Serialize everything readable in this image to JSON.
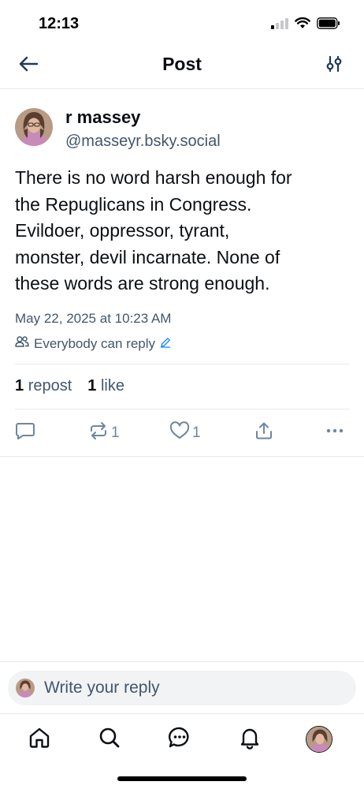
{
  "status_bar": {
    "time": "12:13"
  },
  "header": {
    "title": "Post"
  },
  "post": {
    "author_name": "r massey",
    "author_handle": "@masseyr.bsky.social",
    "text_lines": [
      "There is no word harsh enough for",
      "the Repuglicans in Congress.",
      "Evildoer, oppressor, tyrant,",
      "monster, devil incarnate. None of",
      "these words are strong enough."
    ],
    "timestamp": "May 22, 2025 at 10:23 AM",
    "reply_setting": "Everybody can reply",
    "stats": {
      "repost_count": "1",
      "repost_label": "repost",
      "like_count": "1",
      "like_label": "like"
    },
    "actions": {
      "repost_count": "1",
      "like_count": "1"
    }
  },
  "compose": {
    "placeholder": "Write your reply"
  },
  "colors": {
    "text_primary": "#0b0f14",
    "text_secondary": "#42576c",
    "icon": "#6f869f",
    "accent": "#1083fe"
  }
}
